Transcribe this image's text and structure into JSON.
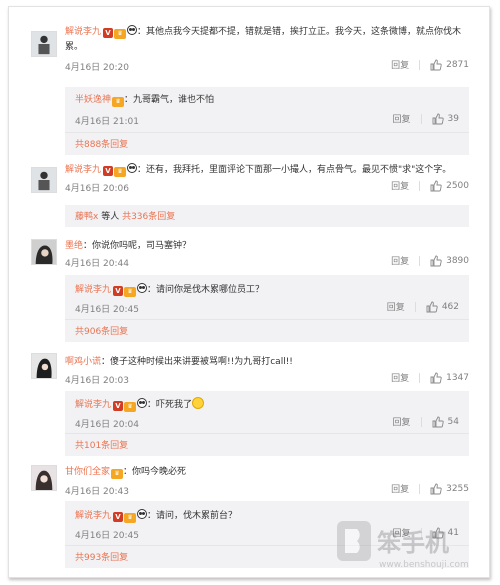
{
  "colors": {
    "name": "#eb7350",
    "text": "#333333",
    "meta": "#808080",
    "sub_bg": "#f2f2f5"
  },
  "actions": {
    "reply": "回复"
  },
  "comments": [
    {
      "user": "解说李九",
      "text": "：其他点我今天提都不提，错就是错，挨打立正。我今天，这条微博，就点你伐木累。",
      "time": "4月16日 20:20",
      "likes": "2871",
      "sub": {
        "user": "半妖逸神",
        "text": "：九哥霸气，谁也不怕",
        "time": "4月16日 21:01",
        "likes": "39"
      },
      "more": "共888条回复"
    },
    {
      "user": "解说李九",
      "text": "：还有，我拜托，里面评论下面那一小撮人，有点骨气。最见不惯\"求\"这个字。",
      "time": "4月16日 20:06",
      "likes": "2500",
      "more_user": "藤鸭x",
      "more_mid": " 等人 ",
      "more": "共336条回复"
    },
    {
      "user": "墨绝",
      "text": "：你说你吗呢，司马塞钟？",
      "time": "4月16日 20:44",
      "likes": "3890",
      "sub": {
        "user": "解说李九",
        "text": "：请问你是伐木累哪位员工？",
        "time": "4月16日 20:45",
        "likes": "462"
      },
      "more": "共906条回复"
    },
    {
      "user": "啊鸡小谎",
      "text": "：傻子这种时候出来讲要被骂啊!!为九哥打call!!",
      "time": "4月16日 20:03",
      "likes": "1347",
      "sub": {
        "user": "解说李九",
        "text": "：吓死我了",
        "time": "4月16日 20:04",
        "likes": "54"
      },
      "more": "共101条回复"
    },
    {
      "user": "甘你们全家",
      "text": "：你吗今晚必死",
      "time": "4月16日 20:43",
      "likes": "3255",
      "sub": {
        "user": "解说李九",
        "text": "：请问，伐木累前台？",
        "time": "4月16日 20:45",
        "likes": "41"
      },
      "more": "共993条回复"
    }
  ],
  "watermark": {
    "brand": "笨手机",
    "url": "www.benshouji.com"
  }
}
